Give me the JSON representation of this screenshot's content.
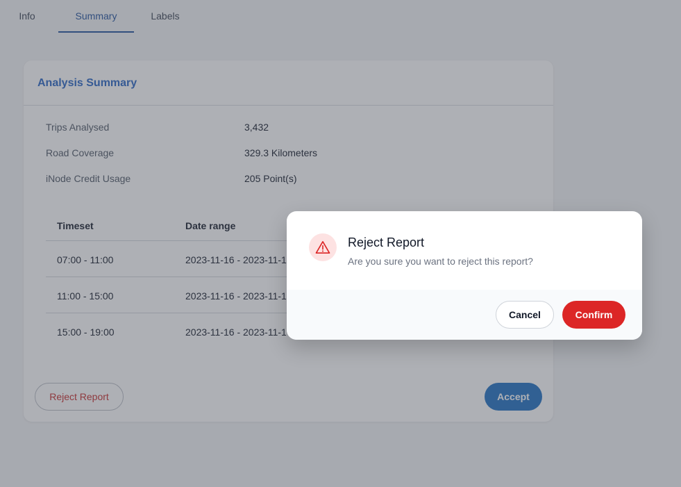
{
  "tabs": [
    {
      "label": "Info"
    },
    {
      "label": "Summary",
      "active": true
    },
    {
      "label": "Labels"
    }
  ],
  "card": {
    "title": "Analysis Summary",
    "stats": [
      {
        "label": "Trips Analysed",
        "value": "3,432"
      },
      {
        "label": "Road Coverage",
        "value": "329.3 Kilometers"
      },
      {
        "label": "iNode Credit Usage",
        "value": "205 Point(s)"
      }
    ],
    "table": {
      "headers": [
        "Timeset",
        "Date range"
      ],
      "rows": [
        {
          "timeset": "07:00 - 11:00",
          "date_range": "2023-11-16 - 2023-11-1"
        },
        {
          "timeset": "11:00 - 15:00",
          "date_range": "2023-11-16 - 2023-11-1"
        },
        {
          "timeset": "15:00 - 19:00",
          "date_range": "2023-11-16 - 2023-11-1"
        }
      ]
    },
    "reject_label": "Reject Report",
    "accept_label": "Accept"
  },
  "modal": {
    "icon": "warning-triangle-icon",
    "title": "Reject Report",
    "message": "Are you sure you want to reject this report?",
    "cancel_label": "Cancel",
    "confirm_label": "Confirm"
  },
  "colors": {
    "accent": "#1e4f9c",
    "danger": "#dc2626",
    "primary_button": "#1d6ec2"
  }
}
